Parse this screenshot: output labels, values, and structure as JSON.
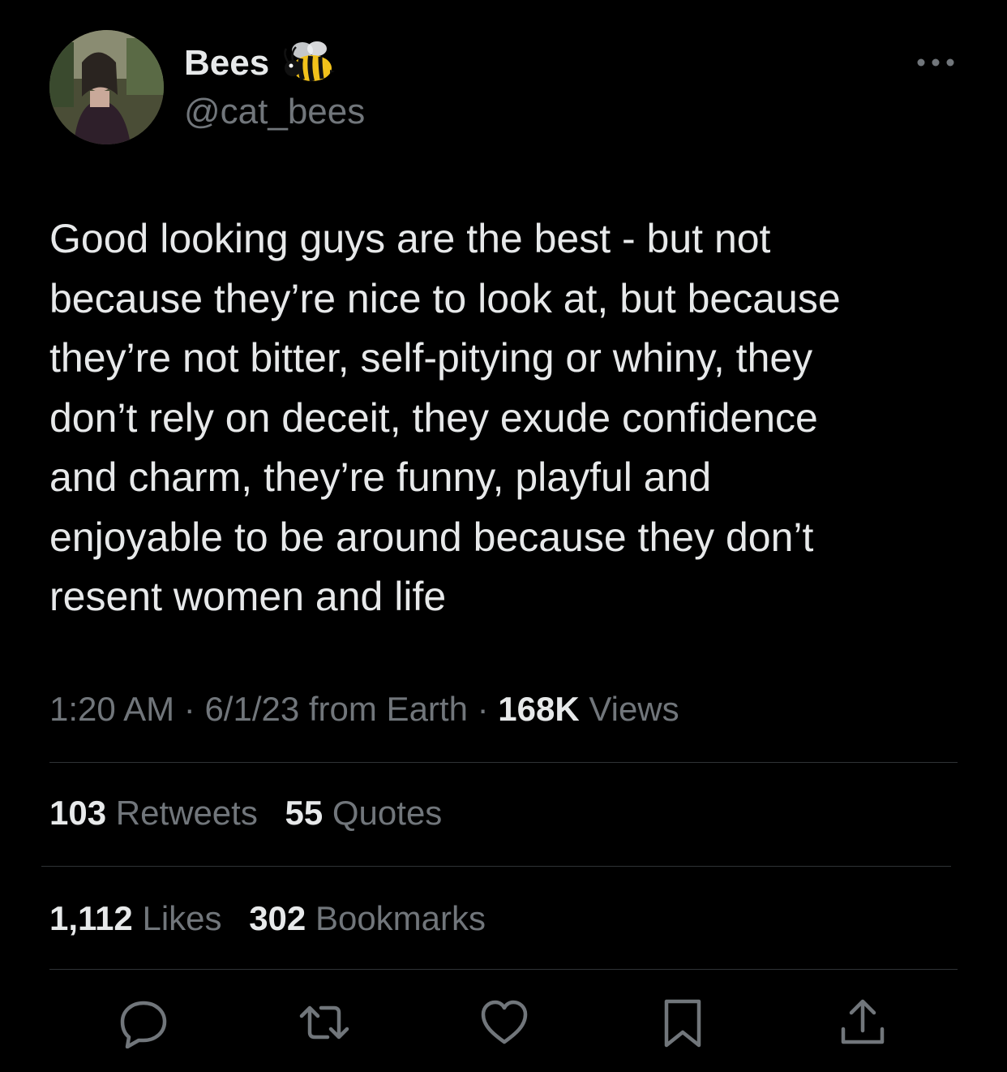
{
  "author": {
    "display_name": "Bees",
    "handle": "@cat_bees",
    "name_emoji": "bee-icon",
    "avatar": "avatar-photo"
  },
  "tweet": {
    "text_lines": [
      "Good looking guys are the best - but not",
      "because they’re nice to look at, but because",
      "they’re not bitter, self-pitying or whiny, they",
      "don’t rely on deceit, they exude confidence",
      "and charm, they’re funny, playful and",
      "enjoyable to be around because they don’t",
      "resent women and life"
    ]
  },
  "meta": {
    "time": "1:20 AM",
    "sep1": " · ",
    "date": "6/1/23",
    "source": " from Earth",
    "sep2": " · ",
    "views_count": "168K",
    "views_label": " Views"
  },
  "stats": {
    "retweets_count": "103",
    "retweets_label": "Retweets",
    "quotes_count": "55",
    "quotes_label": "Quotes",
    "likes_count": "1,112",
    "likes_label": "Likes",
    "bookmarks_count": "302",
    "bookmarks_label": "Bookmarks"
  },
  "actions": [
    "reply-icon",
    "retweet-icon",
    "like-icon",
    "bookmark-icon",
    "share-icon"
  ],
  "colors": {
    "background": "#000000",
    "primary_text": "#e7e9ea",
    "secondary_text": "#71767b",
    "divider": "#2f3336"
  }
}
